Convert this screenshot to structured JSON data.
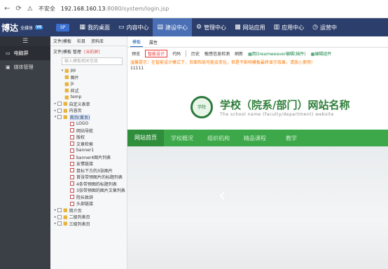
{
  "browser": {
    "back": "←",
    "insecure": "不安全",
    "url_host": "192.168.160.13",
    "url_path": ":8080/system/login.jsp"
  },
  "topbar": {
    "logo": "博达",
    "logo_sub": "全媒体",
    "logo_badge": "V6",
    "pill": "SP",
    "nav": [
      "我的桌面",
      "内容中心",
      "建设中心",
      "管理中心",
      "网站应用",
      "应用中心",
      "运营中"
    ]
  },
  "left": {
    "items": [
      "电脑屏",
      "媒体管理"
    ]
  },
  "tree": {
    "tabs": [
      "文件|模板",
      "栏目",
      "资料库"
    ],
    "sub": "文件|模板 管理",
    "sub_current": "[当前屏]",
    "search": "输入模板相关信息",
    "nodes": [
      {
        "t": "pp",
        "type": "root"
      },
      {
        "t": "图片",
        "type": "folder"
      },
      {
        "t": "js",
        "type": "folder"
      },
      {
        "t": "样式",
        "type": "folder"
      },
      {
        "t": "temp",
        "type": "folder"
      },
      {
        "t": "自定义表单",
        "type": "chk"
      },
      {
        "t": "内容页",
        "type": "chk"
      },
      {
        "t": "首页(首页)",
        "type": "chk",
        "hl": true
      },
      {
        "t": "LOGO",
        "type": "doc"
      },
      {
        "t": "网站导航",
        "type": "doc"
      },
      {
        "t": "版权",
        "type": "doc"
      },
      {
        "t": "文章检索",
        "type": "doc"
      },
      {
        "t": "banner1",
        "type": "doc"
      },
      {
        "t": "banner4图片列表",
        "type": "doc"
      },
      {
        "t": "友情链接",
        "type": "doc"
      },
      {
        "t": "鼠标下方的3张图片",
        "type": "doc"
      },
      {
        "t": "首张带预图片的标题列表",
        "type": "doc"
      },
      {
        "t": "4条带预图的标题列表",
        "type": "doc"
      },
      {
        "t": "3张带预图的图片文章列表",
        "type": "doc"
      },
      {
        "t": "院长致辞",
        "type": "doc"
      },
      {
        "t": "头部链接",
        "type": "doc"
      },
      {
        "t": "简介页",
        "type": "chk"
      },
      {
        "t": "二级列表页",
        "type": "chk"
      },
      {
        "t": "三级列表页",
        "type": "chk"
      }
    ]
  },
  "main": {
    "tabs": [
      "模板",
      "属性"
    ],
    "toolbar": [
      "预览",
      "智能设计",
      "代码",
      "历史",
      "敏感信息检测",
      "刷新",
      "用Dreamweaver编辑",
      "(插件)",
      "编辑组件"
    ],
    "tip": "温馨提示：在智能设计模式下，页面布局可能会变化，但是不影响模板最终显示效果，请放心使用!",
    "counter": "11111"
  },
  "site": {
    "seal": "学院",
    "title": "学校（院系/部门）网站名称",
    "subtitle": "The school name (faculty/department) website",
    "nav": [
      "网站首页",
      "学校概况",
      "组织机构",
      "精品课程",
      "教学"
    ]
  }
}
